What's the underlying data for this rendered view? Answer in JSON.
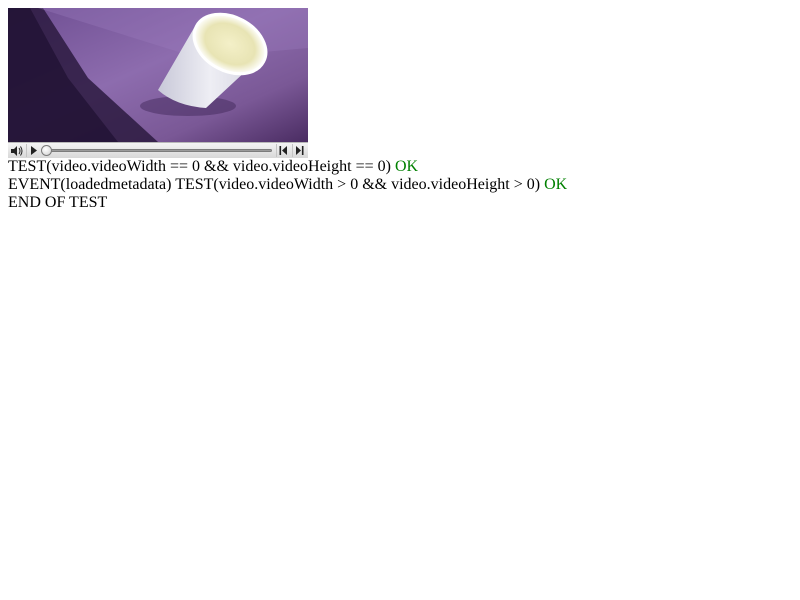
{
  "video": {
    "controls": {
      "progress": 0
    }
  },
  "log": {
    "lines": [
      {
        "text": "TEST(video.videoWidth == 0 && video.videoHeight == 0)",
        "status": "OK"
      },
      {
        "text": "EVENT(loadedmetadata) TEST(video.videoWidth > 0 && video.videoHeight > 0)",
        "status": "OK"
      },
      {
        "text": "END OF TEST",
        "status": ""
      }
    ]
  },
  "colors": {
    "ok": "#008000",
    "text": "#000000"
  },
  "icons": {
    "mute": "speaker-icon",
    "play": "play-icon",
    "seek_back": "seek-back-icon",
    "seek_forward": "seek-forward-icon"
  }
}
